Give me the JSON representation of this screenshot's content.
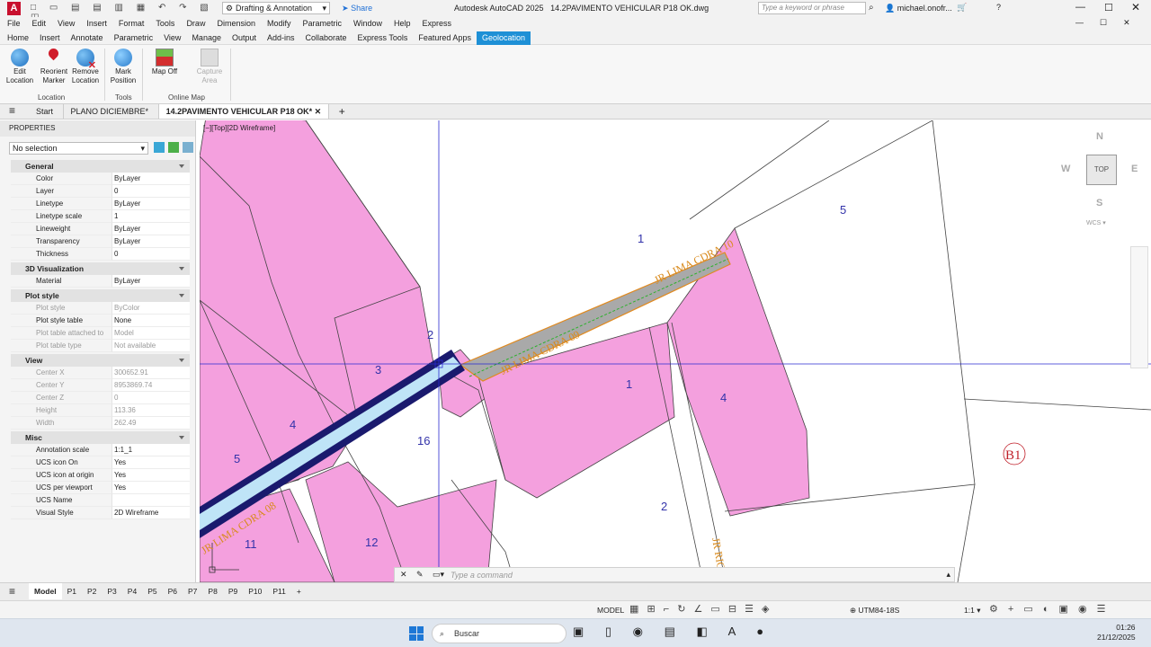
{
  "app": {
    "title": "Autodesk AutoCAD 2025",
    "filename": "14.2PAVIMENTO VEHICULAR P18 OK.dwg",
    "workspace": "Drafting & Annotation",
    "share": "Share",
    "search_placeholder": "Type a keyword or phrase",
    "user": "michael.onofr..."
  },
  "menu": [
    "File",
    "Edit",
    "View",
    "Insert",
    "Format",
    "Tools",
    "Draw",
    "Dimension",
    "Modify",
    "Parametric",
    "Window",
    "Help",
    "Express"
  ],
  "ribbon_tabs": [
    "Home",
    "Insert",
    "Annotate",
    "Parametric",
    "View",
    "Manage",
    "Output",
    "Add-ins",
    "Collaborate",
    "Express Tools",
    "Featured Apps",
    "Geolocation"
  ],
  "ribbon": {
    "edit_location": "Edit Location",
    "reorient_marker": "Reorient Marker",
    "remove_location": "Remove Location",
    "group_location": "Location",
    "mark_position": "Mark Position",
    "group_tools": "Tools",
    "map_off": "Map Off",
    "capture_area": "Capture Area",
    "group_online_map": "Online Map"
  },
  "doc_tabs": [
    "Start",
    "PLANO DICIEMBRE*",
    "14.2PAVIMENTO VEHICULAR P18 OK*"
  ],
  "properties": {
    "title": "PROPERTIES",
    "selection": "No selection",
    "sections": [
      {
        "name": "General",
        "rows": [
          [
            "Color",
            "ByLayer"
          ],
          [
            "Layer",
            "0"
          ],
          [
            "Linetype",
            "ByLayer"
          ],
          [
            "Linetype scale",
            "1"
          ],
          [
            "Lineweight",
            "ByLayer"
          ],
          [
            "Transparency",
            "ByLayer"
          ],
          [
            "Thickness",
            "0"
          ]
        ]
      },
      {
        "name": "3D Visualization",
        "rows": [
          [
            "Material",
            "ByLayer"
          ]
        ]
      },
      {
        "name": "Plot style",
        "rows": [
          [
            "Plot style",
            "ByColor"
          ],
          [
            "Plot style table",
            "None"
          ],
          [
            "Plot table attached to",
            "Model"
          ],
          [
            "Plot table type",
            "Not available"
          ]
        ]
      },
      {
        "name": "View",
        "rows": [
          [
            "Center X",
            "300652.91"
          ],
          [
            "Center Y",
            "8953869.74"
          ],
          [
            "Center Z",
            "0"
          ],
          [
            "Height",
            "113.36"
          ],
          [
            "Width",
            "262.49"
          ]
        ]
      },
      {
        "name": "Misc",
        "rows": [
          [
            "Annotation scale",
            "1:1_1"
          ],
          [
            "UCS icon On",
            "Yes"
          ],
          [
            "UCS icon at origin",
            "Yes"
          ],
          [
            "UCS per viewport",
            "Yes"
          ],
          [
            "UCS Name",
            ""
          ],
          [
            "Visual Style",
            "2D Wireframe"
          ]
        ]
      }
    ]
  },
  "viewport": {
    "label": "[−][Top][2D Wireframe]",
    "command_placeholder": "Type a command",
    "viewcube": {
      "n": "N",
      "s": "S",
      "e": "E",
      "w": "W",
      "top": "TOP",
      "wcs": "WCS"
    },
    "lots": [
      "1",
      "5",
      "2",
      "3",
      "1",
      "4",
      "4",
      "16",
      "5",
      "11",
      "12",
      "2"
    ],
    "streets": [
      "JR LIMA CDRA 10",
      "JR LIMA CDRA 09",
      "JR LIMA CDRA 08",
      "JR RIC"
    ],
    "block": "B1"
  },
  "layout_tabs": [
    "Model",
    "P1",
    "P2",
    "P3",
    "P4",
    "P5",
    "P6",
    "P7",
    "P8",
    "P9",
    "P10",
    "P11"
  ],
  "status": {
    "model": "MODEL",
    "crs": "UTM84-18S",
    "scale": "1:1"
  },
  "taskbar": {
    "search": "Buscar",
    "time": "01:26",
    "date": "21/12/2025"
  },
  "colors": {
    "accent": "#1e90d6",
    "lot_fill": "#f4a0de",
    "road_gray": "#a9a9a9",
    "street_label": "#d98a1c",
    "crosshair": "#2a2ad0"
  }
}
